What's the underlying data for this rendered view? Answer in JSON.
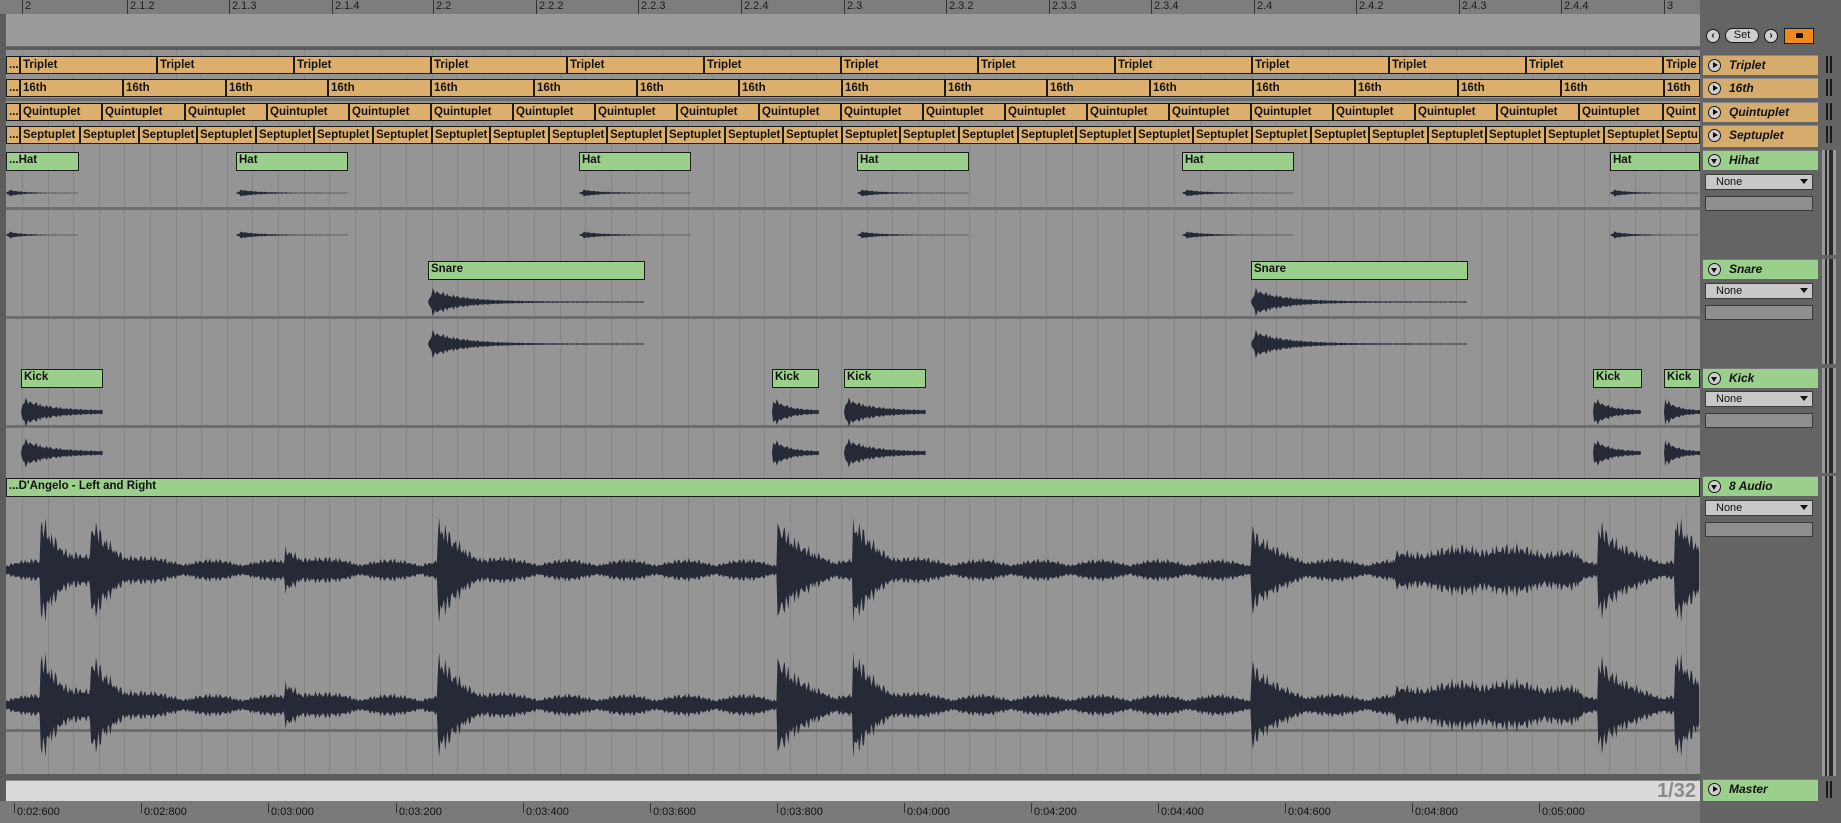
{
  "top_ruler": {
    "labels": [
      "2",
      "2.1.2",
      "2.1.3",
      "2.1.4",
      "2.2",
      "2.2.2",
      "2.2.3",
      "2.2.4",
      "2.3",
      "2.3.2",
      "2.3.3",
      "2.3.4",
      "2.4",
      "2.4.2",
      "2.4.3",
      "2.4.4",
      "3"
    ]
  },
  "controls": {
    "set_label": "Set",
    "prev_icon": "left-arrow-icon",
    "next_icon": "right-arrow-icon",
    "lock_icon": "lock-icon",
    "lock_color": "#ee8a1e"
  },
  "tracks": {
    "triplet": {
      "name": "Triplet",
      "clip_label": "Triplet",
      "first_clip_label": "...",
      "last_clip_label": "Triple"
    },
    "sixteenth": {
      "name": "16th",
      "clip_label": "16th",
      "first_clip_label": "..."
    },
    "quintuplet": {
      "name": "Quintuplet",
      "clip_label": "Quintuplet",
      "first_clip_label": "...",
      "last_clip_label": "Quint"
    },
    "septuplet": {
      "name": "Septuplet",
      "clip_label": "Septuplet",
      "first_clip_label": "...",
      "last_clip_label": "Septu"
    },
    "hihat": {
      "name": "Hihat",
      "first_clip_label": "...Hat",
      "clip_label": "Hat",
      "routing": "None"
    },
    "snare": {
      "name": "Snare",
      "clip_label": "Snare",
      "routing": "None"
    },
    "kick": {
      "name": "Kick",
      "clip_label": "Kick",
      "routing": "None"
    },
    "audio": {
      "name": "8 Audio",
      "clip_label": "...D'Angelo - Left and Right",
      "routing": "None"
    },
    "master": {
      "name": "Master"
    }
  },
  "zoom_level": "1/32",
  "time_ruler": {
    "labels": [
      "0:02:600",
      "0:02:800",
      "0:03:000",
      "0:03:200",
      "0:03:400",
      "0:03:600",
      "0:03:800",
      "0:04:000",
      "0:04:200",
      "0:04:400",
      "0:04:600",
      "0:04:800",
      "0:05:000"
    ]
  },
  "colors": {
    "groove_clip": "#dcb06c",
    "drum_clip": "#9bcf8c",
    "waveform": "#262a36"
  }
}
